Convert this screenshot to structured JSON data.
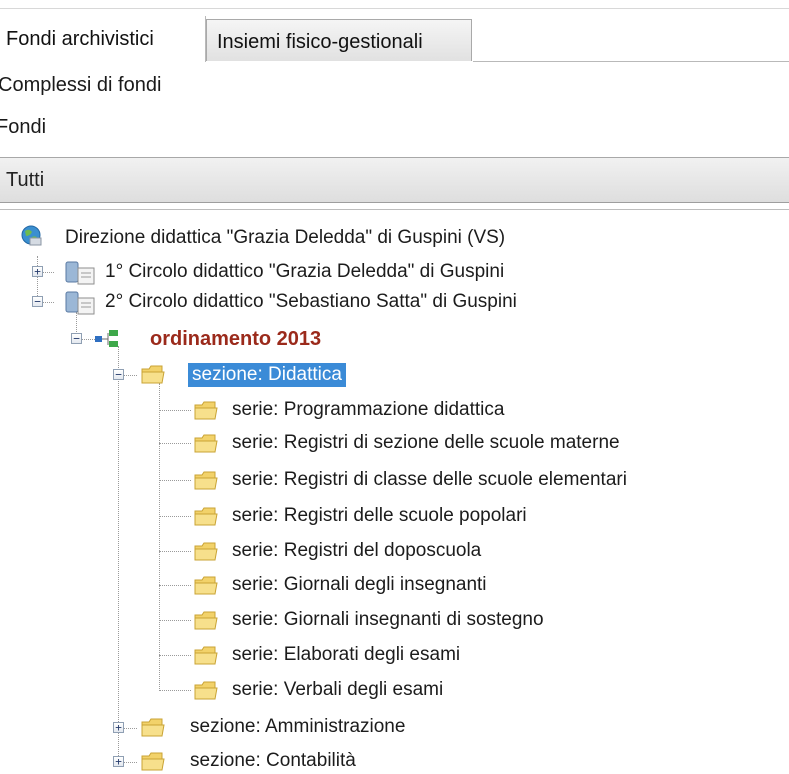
{
  "tabs": [
    {
      "label": "Fondi archivistici",
      "active": true
    },
    {
      "label": "Insiemi fisico-gestionali",
      "active": false
    }
  ],
  "nav_links": [
    "Complessi di fondi",
    "Fondi"
  ],
  "filter_header": "Tutti",
  "tree": {
    "root": "Direzione didattica \"Grazia Deledda\" di Guspini (VS)",
    "nodes": [
      "1° Circolo didattico \"Grazia Deledda\" di Guspini",
      "2° Circolo didattico \"Sebastiano Satta\" di Guspini",
      "ordinamento 2013",
      "sezione: Didattica",
      "serie: Programmazione didattica",
      "serie: Registri di sezione delle scuole materne",
      "serie: Registri di classe delle scuole elementari",
      "serie: Registri delle scuole popolari",
      "serie: Registri del doposcuola",
      "serie: Giornali degli insegnanti",
      "serie: Giornali insegnanti di sostegno",
      "serie: Elaborati degli esami",
      "serie: Verbali degli esami",
      "sezione: Amministrazione",
      "sezione: Contabilità"
    ],
    "expanders": {
      "collapsed": "+",
      "expanded": "−"
    }
  },
  "colors": {
    "selection": "#3b8bd7",
    "ordinamento_text": "#9b2a1b",
    "folder": "#f2d26a"
  },
  "icons": [
    "globe-icon",
    "database-icon",
    "hierarchy-icon",
    "folder-icon"
  ]
}
